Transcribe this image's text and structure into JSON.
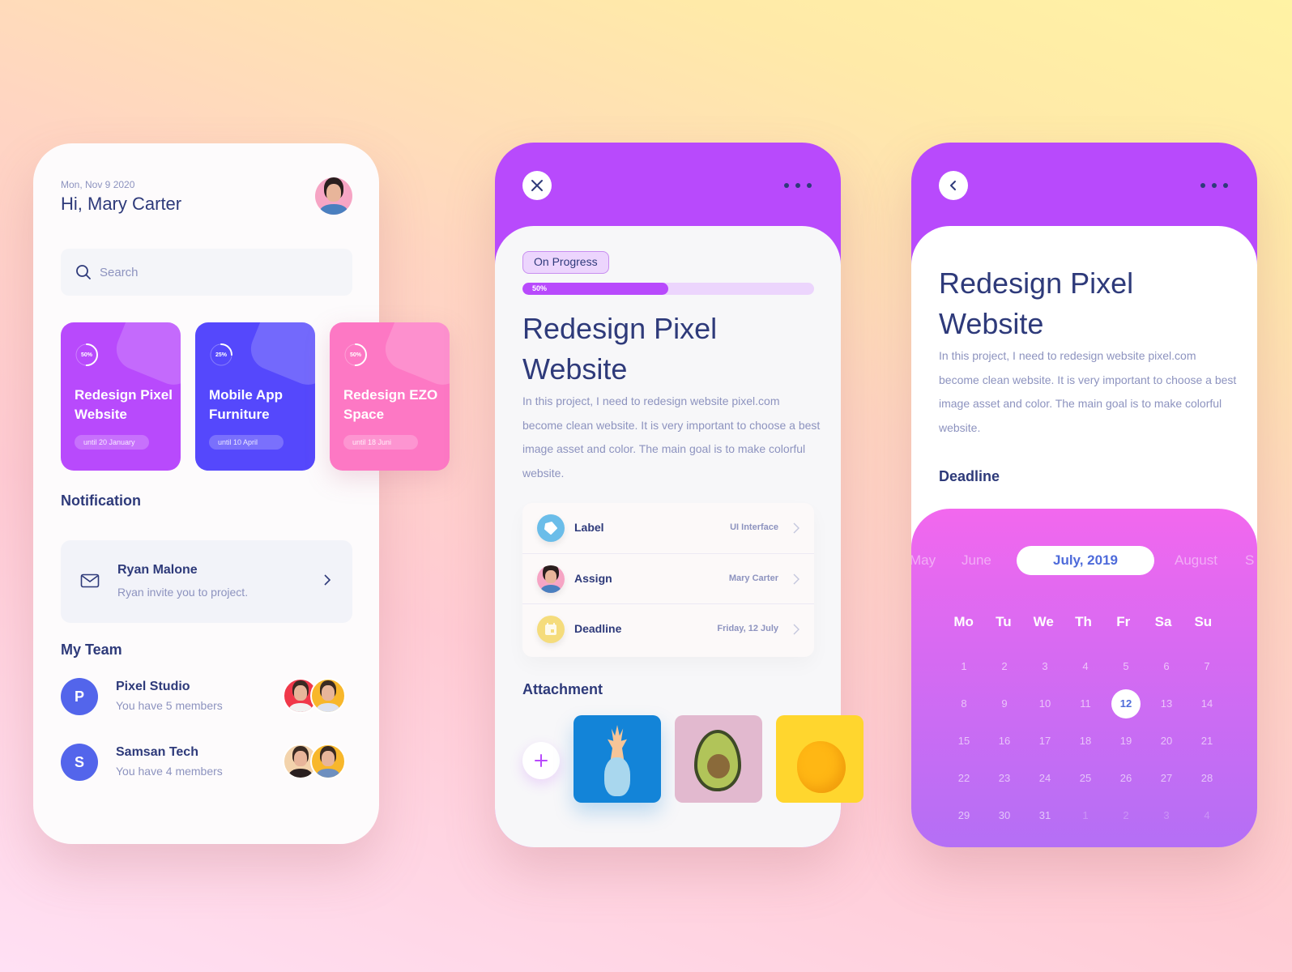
{
  "colors": {
    "primary_purple": "#b84afc",
    "indigo": "#5548fc",
    "pink": "#fd78c4",
    "navy_text": "#2e3a7a",
    "muted_text": "#8d93bf",
    "team_avatar": "#5365eb"
  },
  "home": {
    "date": "Mon, Nov 9 2020",
    "greeting": "Hi, Mary Carter",
    "search": {
      "placeholder": "Search"
    },
    "projects": [
      {
        "progress_label": "50%",
        "progress": 0.5,
        "title": "Redesign Pixel Website",
        "until": "until 20 January",
        "color": "#b84afc"
      },
      {
        "progress_label": "25%",
        "progress": 0.25,
        "title": "Mobile App Furniture",
        "until": "until 10 April",
        "color": "#5548fc"
      },
      {
        "progress_label": "50%",
        "progress": 0.5,
        "title": "Redesign EZO Space",
        "until": "until 18 Juni",
        "color": "#fd78c4"
      }
    ],
    "notification_title": "Notification",
    "notification": {
      "name": "Ryan Malone",
      "message": "Ryan invite you to project."
    },
    "team_title": "My Team",
    "teams": [
      {
        "initial": "P",
        "name": "Pixel Studio",
        "members": "You have 5 members"
      },
      {
        "initial": "S",
        "name": "Samsan Tech",
        "members": "You have 4 members"
      }
    ]
  },
  "detail": {
    "status": "On Progress",
    "progress_label": "50%",
    "progress": 0.5,
    "title": "Redesign Pixel Website",
    "description": "In this project, I need to redesign website pixel.com become clean website. It is very important to choose a best image asset and color. The main goal is to make colorful website.",
    "info": [
      {
        "label": "Label",
        "value": "UI Interface",
        "icon": "tag-icon"
      },
      {
        "label": "Assign",
        "value": "Mary Carter",
        "icon": "avatar"
      },
      {
        "label": "Deadline",
        "value": "Friday, 12 July",
        "icon": "calendar-icon"
      }
    ],
    "attachment_title": "Attachment",
    "attachments": [
      "pineapple",
      "avocado",
      "lemon"
    ]
  },
  "calendar_screen": {
    "title": "Redesign Pixel Website",
    "description": "In this project, I need to redesign website pixel.com become clean website. It is very important to choose a best image asset and color. The main goal is to make colorful website.",
    "deadline_title": "Deadline",
    "months": [
      "May",
      "June",
      "August",
      "S"
    ],
    "current_month": "July, 2019",
    "weekdays": [
      "Mo",
      "Tu",
      "We",
      "Th",
      "Fr",
      "Sa",
      "Su"
    ],
    "days": [
      "1",
      "2",
      "3",
      "4",
      "5",
      "6",
      "7",
      "8",
      "9",
      "10",
      "11",
      "12",
      "13",
      "14",
      "15",
      "16",
      "17",
      "18",
      "19",
      "20",
      "21",
      "22",
      "23",
      "24",
      "25",
      "26",
      "27",
      "28",
      "29",
      "30",
      "31",
      "1",
      "2",
      "3",
      "4"
    ],
    "selected_day": "12",
    "outside_start_index": 31
  }
}
